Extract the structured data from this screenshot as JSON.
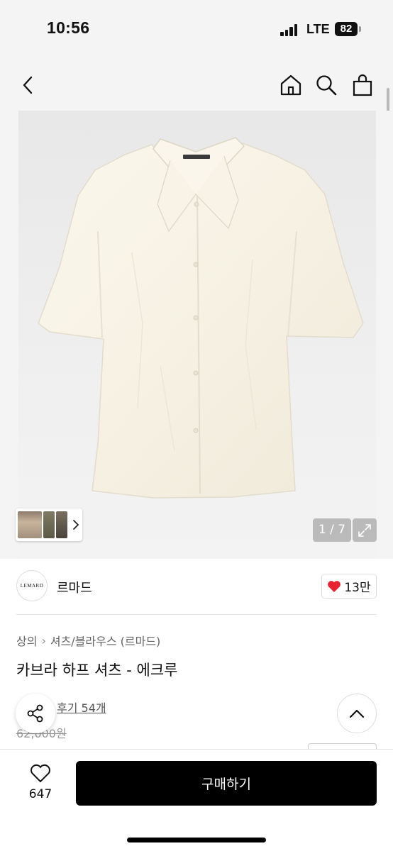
{
  "status_bar": {
    "time": "10:56",
    "network": "LTE",
    "battery": "82"
  },
  "nav": {
    "back_icon": "chevron-left-icon",
    "home_icon": "home-icon",
    "search_icon": "search-icon",
    "bag_icon": "shopping-bag-icon"
  },
  "gallery": {
    "counter": "1 / 7",
    "expand_icon": "expand-icon"
  },
  "brand": {
    "logo_text": "LEMARD",
    "name": "르마드",
    "likes": "13만",
    "like_color": "#e8232f"
  },
  "product": {
    "breadcrumb": [
      "상의",
      "셔츠/블라우스 (르마드)"
    ],
    "title": "카브라 하프 셔츠 - 에크루",
    "reviews": "후기 54개",
    "original_price": "62,000원"
  },
  "bottom_bar": {
    "wish_count": "647",
    "buy_label": "구매하기"
  }
}
